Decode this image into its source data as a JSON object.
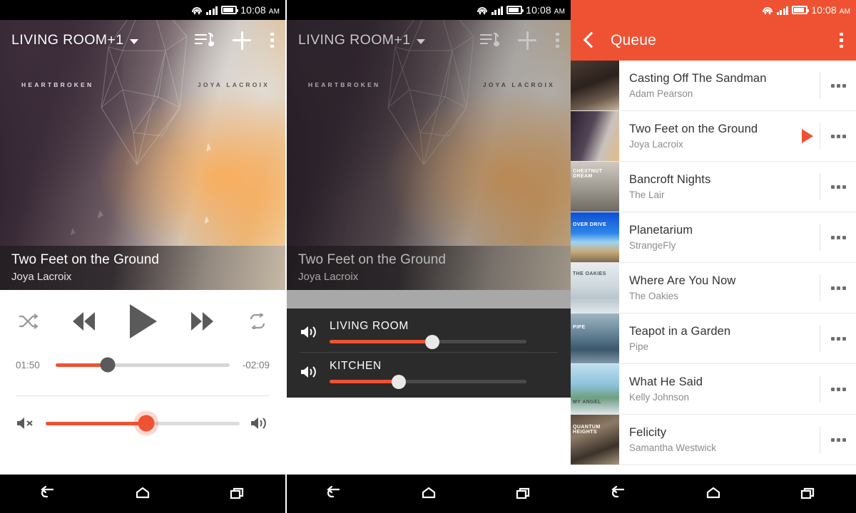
{
  "status_bar": {
    "time": "10:08",
    "ampm": "AM",
    "icons": [
      "wifi-icon",
      "cellular-signal-icon",
      "battery-icon"
    ]
  },
  "panel_player": {
    "toolbar": {
      "zone_label": "LIVING ROOM+1",
      "dropdown_icon": "chevron-down-icon",
      "queue_icon": "queue-music-icon",
      "add_icon": "plus-icon",
      "overflow_icon": "overflow-menu-icon"
    },
    "album_art": {
      "album_title": "HEARTBROKEN",
      "album_artist": "JOYA LACROIX"
    },
    "now_playing": {
      "title": "Two Feet on the Ground",
      "artist": "Joya Lacroix"
    },
    "transport": {
      "shuffle": "shuffle-icon",
      "previous": "previous-track-icon",
      "play": "play-icon",
      "next": "next-track-icon",
      "repeat": "repeat-icon"
    },
    "progress": {
      "elapsed": "01:50",
      "remaining": "-02:09",
      "percent": 30
    },
    "volume": {
      "mute_icon": "volume-mute-icon",
      "max_icon": "volume-high-icon",
      "percent": 52
    },
    "accent_color": "#ef5233"
  },
  "panel_zones": {
    "toolbar": {
      "zone_label": "LIVING ROOM+1"
    },
    "now_playing": {
      "title": "Two Feet on the Ground",
      "artist": "Joya Lacroix"
    },
    "zones": [
      {
        "name": "LIVING ROOM",
        "percent": 52,
        "speaker_icon": "speaker-icon"
      },
      {
        "name": "KITCHEN",
        "percent": 35,
        "speaker_icon": "speaker-icon"
      }
    ],
    "volume": {
      "mute_icon": "volume-mute-icon",
      "max_icon": "volume-high-icon",
      "percent": 52
    }
  },
  "panel_queue": {
    "toolbar": {
      "back_icon": "back-arrow-icon",
      "title": "Queue",
      "overflow_icon": "overflow-menu-icon"
    },
    "rows": [
      {
        "song": "Casting Off The Sandman",
        "artist": "Adam Pearson",
        "art_caption": "",
        "playing": false
      },
      {
        "song": "Two Feet on the Ground",
        "artist": "Joya Lacroix",
        "art_caption": "",
        "playing": true
      },
      {
        "song": "Bancroft Nights",
        "artist": "The Lair",
        "art_caption": "CHESTNUT DREAM",
        "playing": false
      },
      {
        "song": "Planetarium",
        "artist": "StrangeFly",
        "art_caption": "OVER DRIVE",
        "playing": false
      },
      {
        "song": "Where Are You Now",
        "artist": "The Oakies",
        "art_caption": "THE OAKIES",
        "playing": false
      },
      {
        "song": "Teapot in a Garden",
        "artist": "Pipe",
        "art_caption": "PIPE",
        "playing": false
      },
      {
        "song": "What He Said",
        "artist": "Kelly Johnson",
        "art_caption": "MY ANGEL",
        "playing": false
      },
      {
        "song": "Felicity",
        "artist": "Samantha Westwick",
        "art_caption": "QUANTUM HEIGHTS",
        "playing": false
      }
    ],
    "overflow_label": "...",
    "header_color": "#ef5233"
  },
  "nav_bar": {
    "back": "back-nav-icon",
    "home": "home-nav-icon",
    "recents": "recents-nav-icon"
  }
}
